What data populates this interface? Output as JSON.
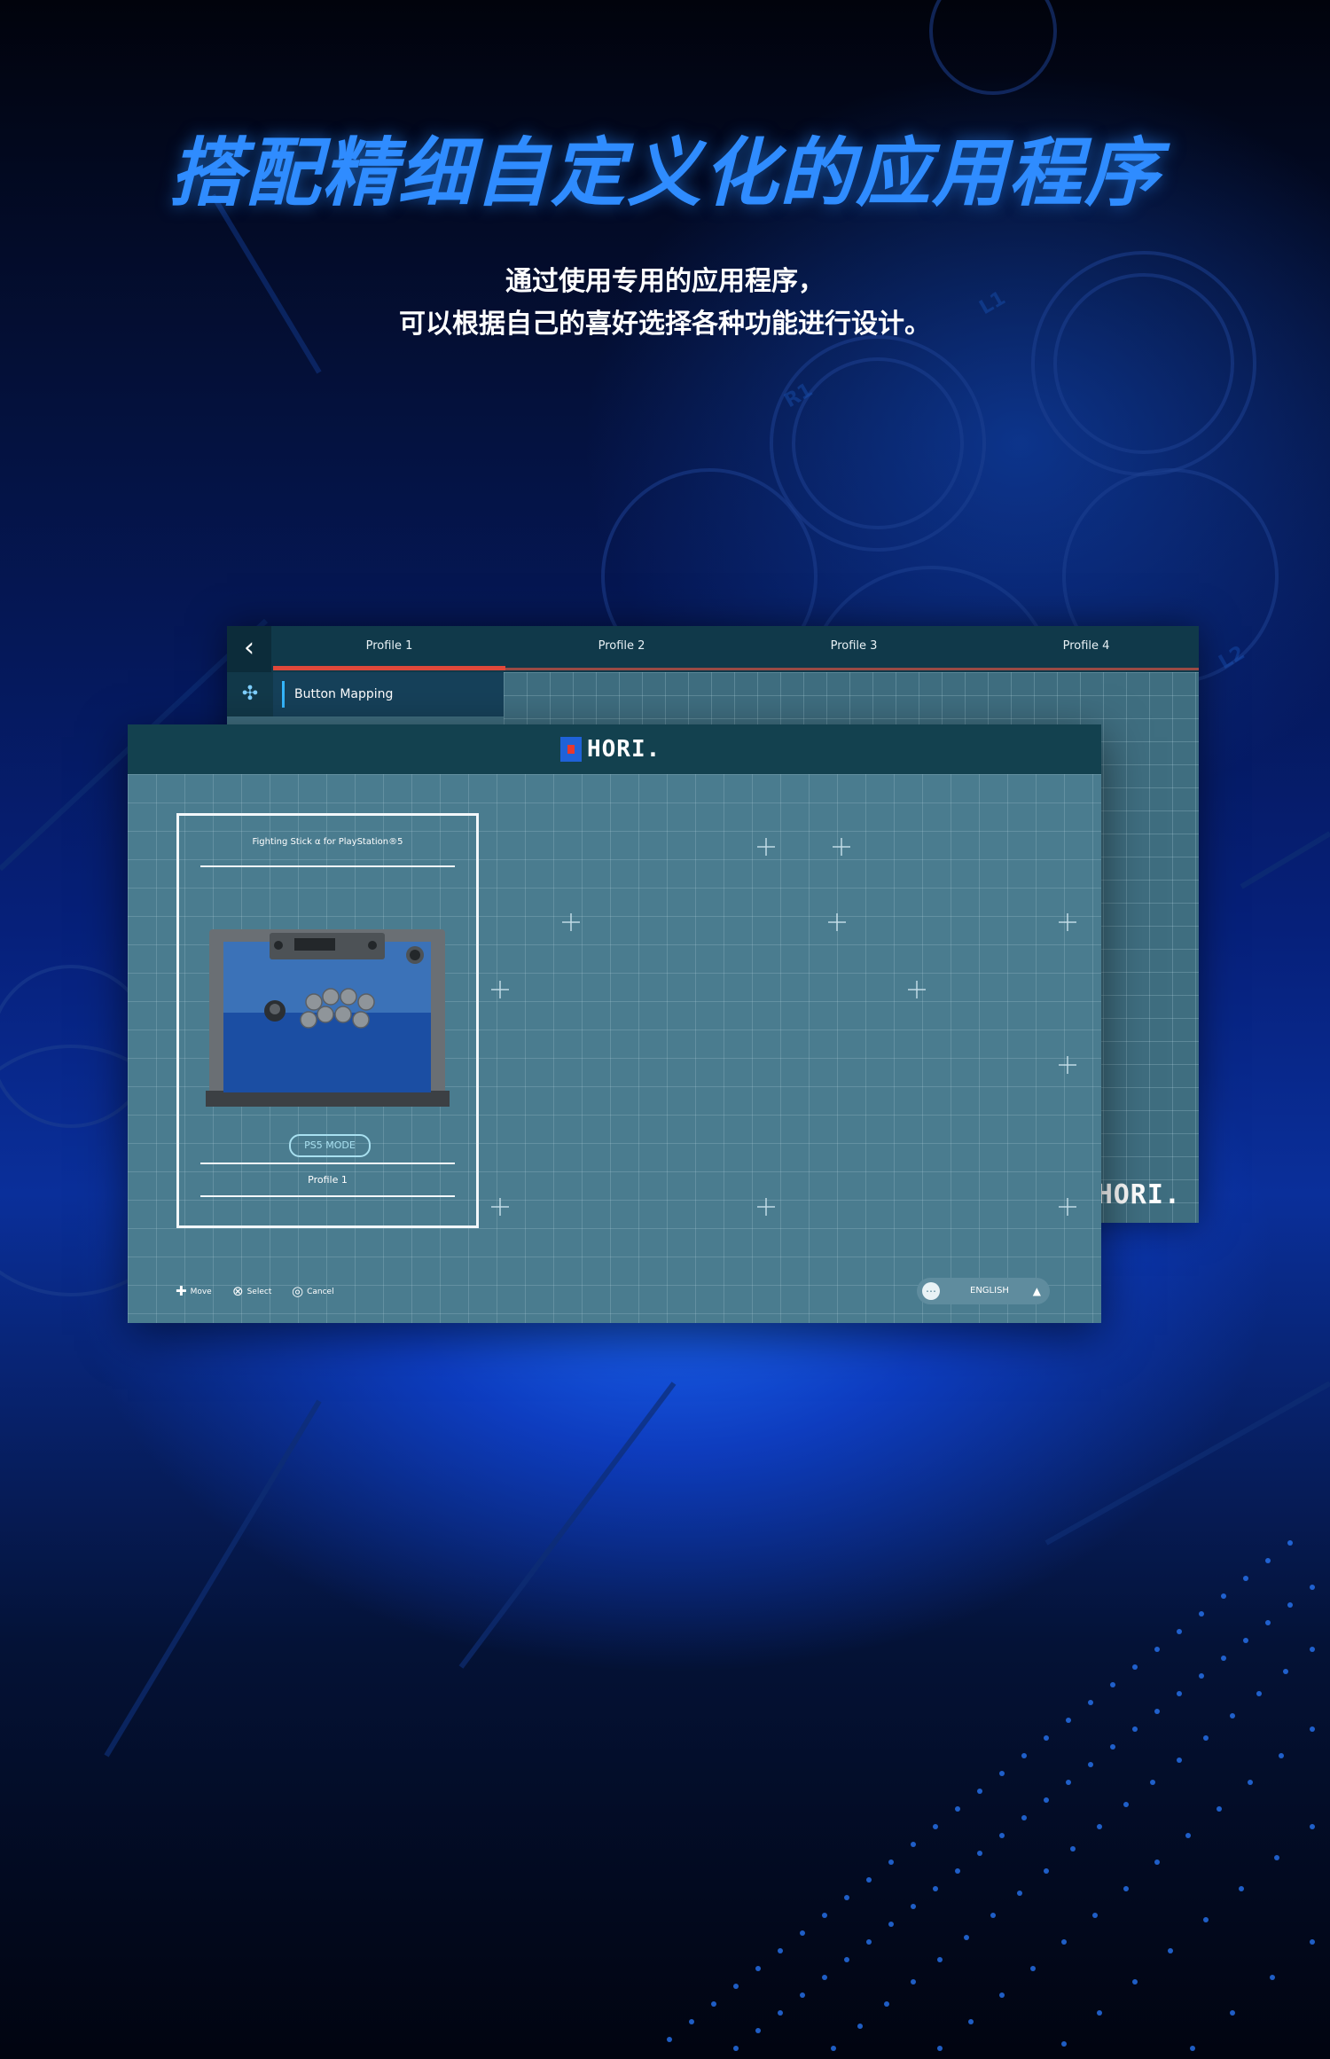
{
  "headline": "搭配精细自定义化的应用程序",
  "subtitle": {
    "line1": "通过使用专用的应用程序，",
    "line2": "可以根据自己的喜好选择各种功能进行设计。"
  },
  "colors": {
    "headline": "#2f8cff",
    "window_bg": "#4a7c8f",
    "window_header": "#13414f",
    "active_tab_accent": "#e0483a",
    "sidebar_accent": "#35b7ff"
  },
  "back_window": {
    "back_icon": "chevron-left-icon",
    "tabs": [
      "Profile 1",
      "Profile 2",
      "Profile 3",
      "Profile 4"
    ],
    "active_tab": "Profile 1",
    "sidebar_icon": "dpad-icon",
    "sidebar_item": "Button Mapping",
    "logo_text": "HORI."
  },
  "front_window": {
    "logo_text": "HORI.",
    "device_card": {
      "title": "Fighting Stick α for PlayStation®5",
      "mode_button": "PS5 MODE",
      "profile": "Profile 1"
    },
    "controls": [
      {
        "icon": "plus-dpad-icon",
        "glyph": "✚",
        "label": "Move"
      },
      {
        "icon": "cross-button-icon",
        "glyph": "⊗",
        "label": "Select"
      },
      {
        "icon": "circle-button-icon",
        "glyph": "◎",
        "label": "Cancel"
      }
    ],
    "language": {
      "icon": "globe-icon",
      "label": "ENGLISH",
      "toggle_icon": "caret-up-icon"
    }
  }
}
